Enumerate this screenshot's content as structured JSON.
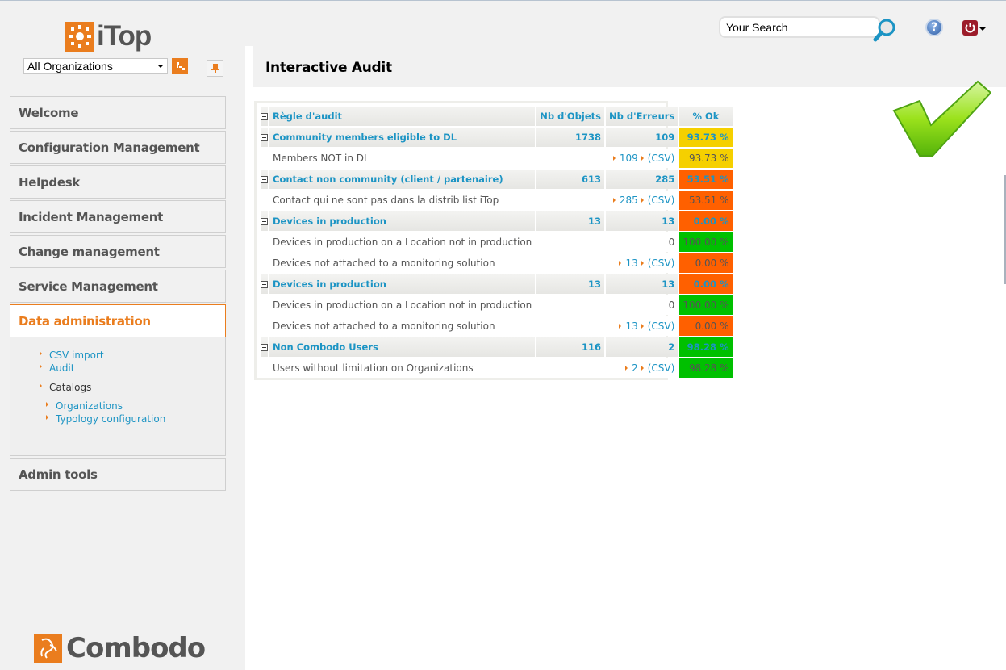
{
  "app": {
    "logo_text": "iTop",
    "vendor_logo_text": "Combodo"
  },
  "org_selector": {
    "value": "All Organizations"
  },
  "search": {
    "placeholder": "Your Search"
  },
  "sidebar": {
    "menus": [
      {
        "label": "Welcome"
      },
      {
        "label": "Configuration Management"
      },
      {
        "label": "Helpdesk"
      },
      {
        "label": "Incident Management"
      },
      {
        "label": "Change management"
      },
      {
        "label": "Service Management"
      },
      {
        "label": "Data administration",
        "active": true
      },
      {
        "label": "Admin tools"
      }
    ],
    "submenu": {
      "csv_import": "CSV import",
      "audit": "Audit",
      "catalogs": "Catalogs",
      "organizations": "Organizations",
      "typology": "Typology configuration"
    }
  },
  "page": {
    "title": "Interactive Audit"
  },
  "audit_table": {
    "headers": {
      "rule": "Règle d'audit",
      "objects": "Nb d'Objets",
      "errors": "Nb d'Erreurs",
      "ok": "% Ok"
    },
    "colors": {
      "yellow": "#f5d000",
      "orange": "#ff6000",
      "green": "#00c000"
    },
    "categories": [
      {
        "name": "Community members eligible to DL",
        "objects": "1738",
        "errors": "109",
        "ok": "93.73 %",
        "color": "#f5d000",
        "rules": [
          {
            "name": "Members NOT in DL",
            "errors": "109",
            "csv": "(CSV)",
            "ok": "93.73 %",
            "color": "#f5d000"
          }
        ]
      },
      {
        "name": "Contact non community (client / partenaire)",
        "objects": "613",
        "errors": "285",
        "ok": "53.51 %",
        "color": "#ff6000",
        "rules": [
          {
            "name": "Contact qui ne sont pas dans la distrib list iTop",
            "errors": "285",
            "csv": "(CSV)",
            "ok": "53.51 %",
            "color": "#ff6000"
          }
        ]
      },
      {
        "name": "Devices in production",
        "objects": "13",
        "errors": "13",
        "ok": "0.00 %",
        "color": "#ff6000",
        "rules": [
          {
            "name": "Devices in production on a Location not in production",
            "errors": "0",
            "csv": "",
            "ok": "100.00 %",
            "color": "#00c000"
          },
          {
            "name": "Devices not attached to a monitoring solution",
            "errors": "13",
            "csv": "(CSV)",
            "ok": "0.00 %",
            "color": "#ff6000"
          }
        ]
      },
      {
        "name": "Devices in production",
        "objects": "13",
        "errors": "13",
        "ok": "0.00 %",
        "color": "#ff6000",
        "rules": [
          {
            "name": "Devices in production on a Location not in production",
            "errors": "0",
            "csv": "",
            "ok": "100.00 %",
            "color": "#00c000"
          },
          {
            "name": "Devices not attached to a monitoring solution",
            "errors": "13",
            "csv": "(CSV)",
            "ok": "0.00 %",
            "color": "#ff6000"
          }
        ]
      },
      {
        "name": "Non Combodo Users",
        "objects": "116",
        "errors": "2",
        "ok": "98.28 %",
        "color": "#00c000",
        "rules": [
          {
            "name": "Users without limitation on Organizations",
            "errors": "2",
            "csv": "(CSV)",
            "ok": "98.28 %",
            "color": "#00c000"
          }
        ]
      }
    ]
  }
}
